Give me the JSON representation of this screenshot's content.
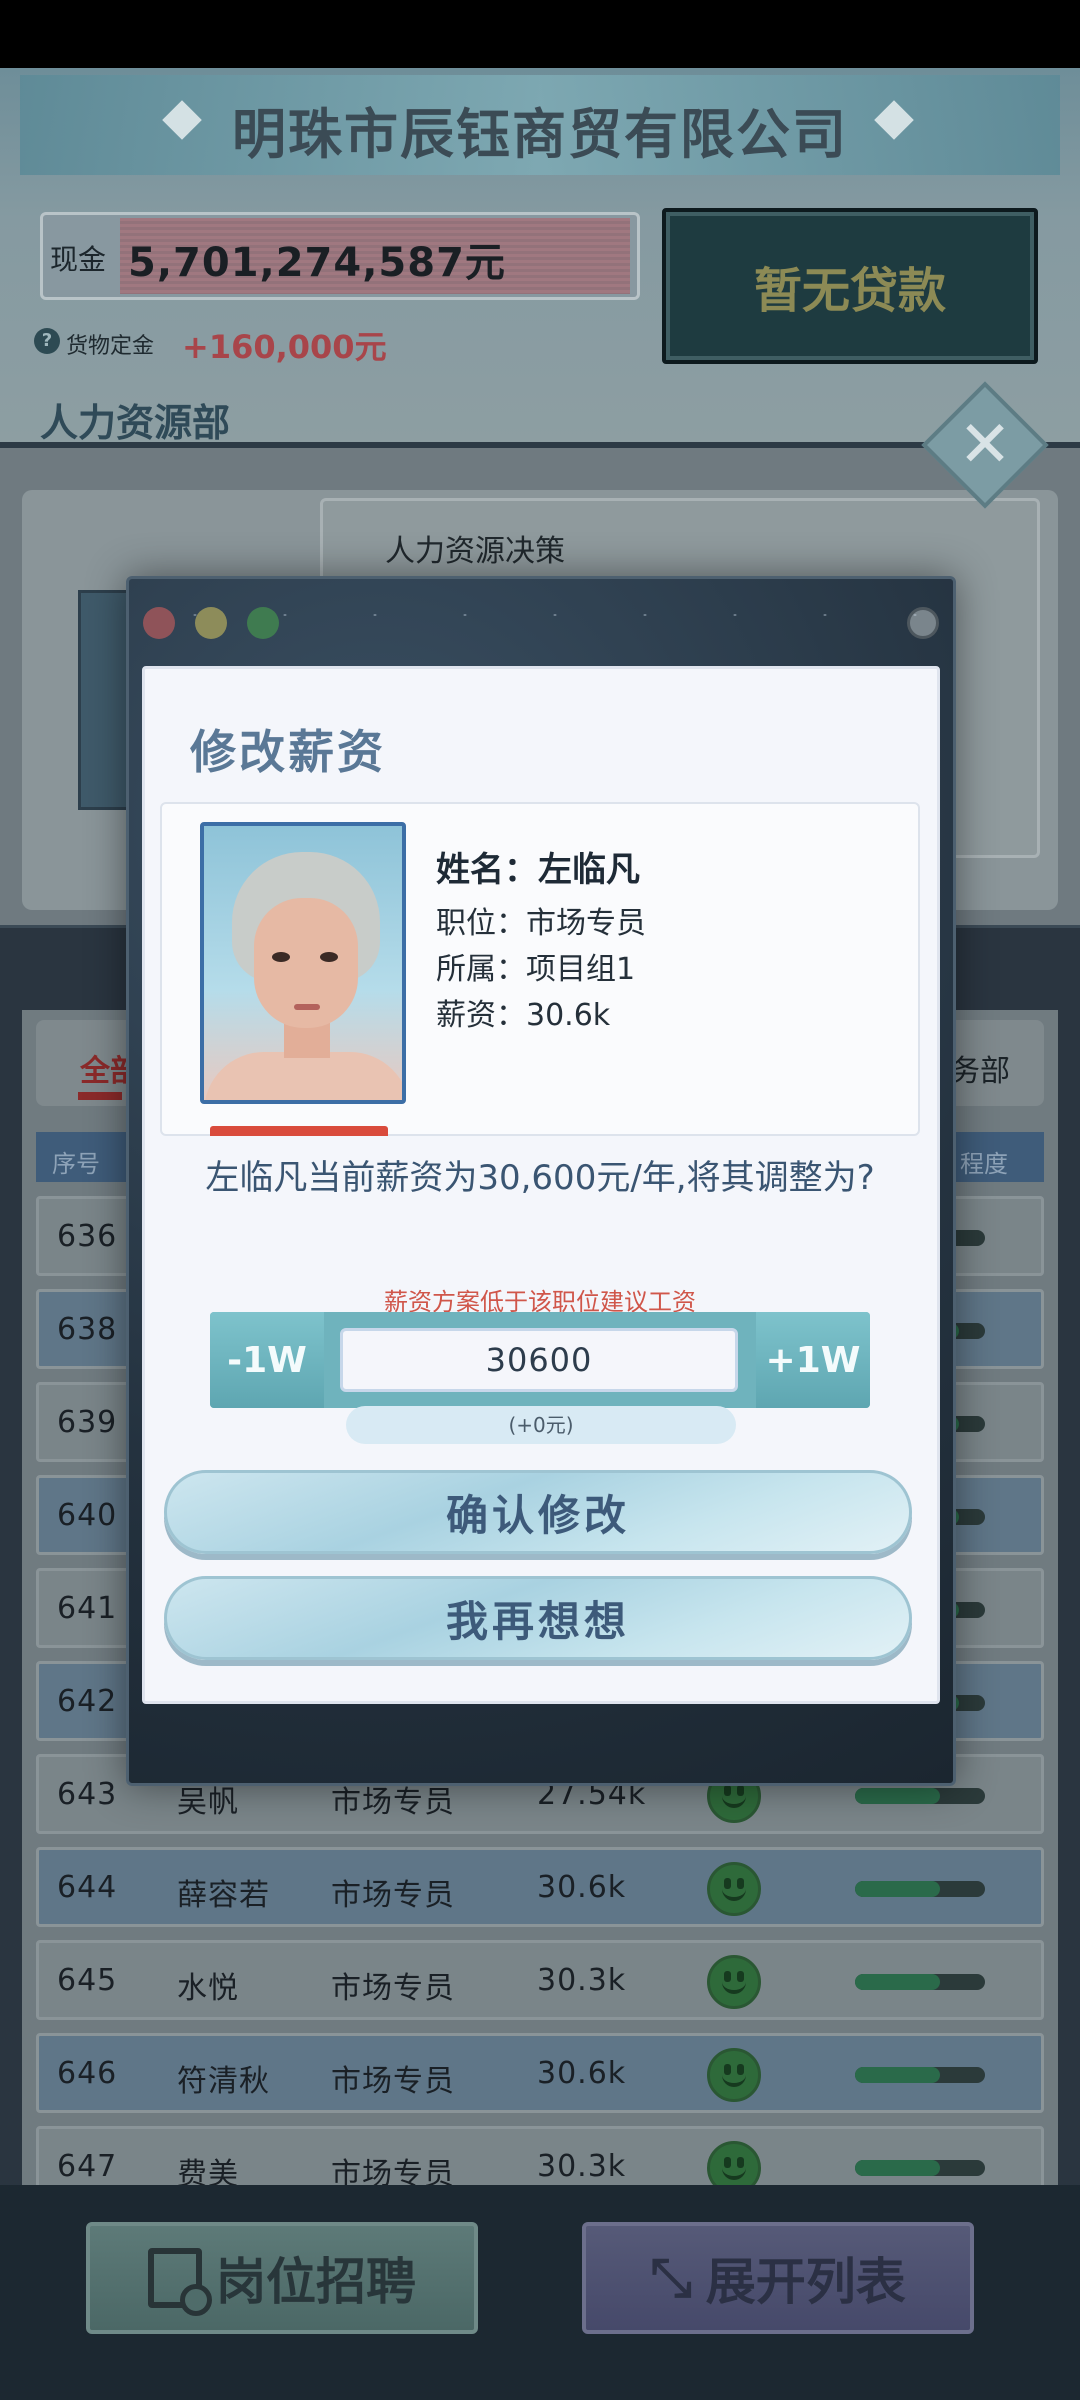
{
  "company": {
    "name": "明珠市辰钰商贸有限公司"
  },
  "finance": {
    "cash_label": "现金",
    "cash_value": "5,701,274,587元",
    "loan_button": "暂无贷款",
    "deposit_label": "货物定金",
    "deposit_value": "+160,000元"
  },
  "department": {
    "title": "人力资源部"
  },
  "hr_panel": {
    "decision_title": "人力资源决策"
  },
  "tabs": {
    "all": "全部",
    "right": "务部"
  },
  "list_header": {
    "no": "序号",
    "right": "程度"
  },
  "employees": [
    {
      "no": "636",
      "name": "",
      "position": "",
      "salary": "",
      "mood": 0.6
    },
    {
      "no": "638",
      "name": "",
      "position": "",
      "salary": "",
      "mood": 0.8
    },
    {
      "no": "639",
      "name": "",
      "position": "",
      "salary": "",
      "mood": 0.8
    },
    {
      "no": "640",
      "name": "",
      "position": "",
      "salary": "",
      "mood": 0.8
    },
    {
      "no": "641",
      "name": "",
      "position": "",
      "salary": "",
      "mood": 0.8
    },
    {
      "no": "642",
      "name": "",
      "position": "",
      "salary": "",
      "mood": 0.8
    },
    {
      "no": "643",
      "name": "吴帆",
      "position": "市场专员",
      "salary": "27.54k",
      "mood": 0.65
    },
    {
      "no": "644",
      "name": "薛容若",
      "position": "市场专员",
      "salary": "30.6k",
      "mood": 0.65
    },
    {
      "no": "645",
      "name": "水悦",
      "position": "市场专员",
      "salary": "30.3k",
      "mood": 0.65
    },
    {
      "no": "646",
      "name": "符清秋",
      "position": "市场专员",
      "salary": "30.6k",
      "mood": 0.65
    },
    {
      "no": "647",
      "name": "费美",
      "position": "市场专员",
      "salary": "30.3k",
      "mood": 0.65
    }
  ],
  "bottom": {
    "recruit_label": "岗位招聘",
    "expand_label": "展开列表"
  },
  "dialog": {
    "title": "修改薪资",
    "employee_name": "姓名：左临凡",
    "position": "职位：市场专员",
    "group": "所属：项目组1",
    "salary": "薪资：30.6k",
    "question": "左临凡当前薪资为30,600元/年,将其调整为?",
    "warning": "薪资方案低于该职位建议工资",
    "minus_label": "-1W",
    "plus_label": "+1W",
    "salary_input_value": "30600",
    "delta": "(+0元)",
    "confirm_label": "确认修改",
    "think_label": "我再想想"
  }
}
